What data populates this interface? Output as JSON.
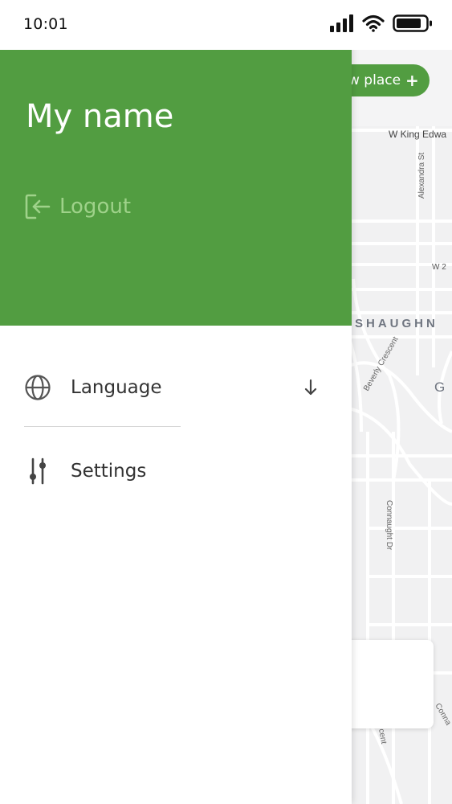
{
  "status_bar": {
    "time": "10:01",
    "icons": [
      "signal-icon",
      "wifi-icon",
      "battery-icon"
    ]
  },
  "map": {
    "add_place_label": "w place",
    "add_place_icon": "plus-icon",
    "labels": {
      "street_top": "W King Edwa",
      "alexandra": "Alexandra St",
      "w2": "W 2",
      "area": "SHAUGHN",
      "beverly": "Beverly Crescent",
      "g": "G",
      "connaught": "Connaught Dr",
      "bottom1": "Conna",
      "bottom2": "cent"
    }
  },
  "drawer": {
    "user_name": "My name",
    "logout_label": "Logout",
    "logout_icon": "logout-icon",
    "menu": [
      {
        "label": "Language",
        "icon": "globe-icon",
        "trailing_icon": "arrow-down-icon"
      },
      {
        "label": "Settings",
        "icon": "sliders-icon"
      }
    ]
  },
  "colors": {
    "brand_green": "#529d41",
    "logout_green": "#9fd28a",
    "map_bg": "#f4f4f5"
  }
}
